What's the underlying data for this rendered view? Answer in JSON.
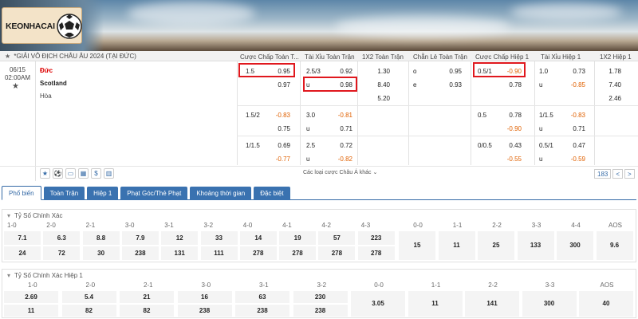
{
  "brand": {
    "logo_text": "KEONHACAI"
  },
  "match_header": {
    "star": "★",
    "tournament": "*GIẢI VÔ ĐỊCH CHÂU ÂU 2024 (TẠI ĐỨC)"
  },
  "columns": [
    "Cược Chấp Toàn T...",
    "Tài Xỉu Toàn Trận",
    "1X2 Toàn Trận",
    "Chẵn Lẻ Toàn Trận",
    "Cược Chấp Hiệp 1",
    "Tài Xỉu Hiệp 1",
    "1X2 Hiệp 1"
  ],
  "match": {
    "date": "06/15",
    "time": "02:00AM",
    "home": "Đức",
    "away": "Scotland",
    "draw": "Hòa"
  },
  "rows": [
    {
      "hdp": "1.5",
      "hdp_home": "0.95",
      "hdp_away": "0.97",
      "ou": "2.5/3",
      "ou_over": "0.92",
      "ou_u": "u",
      "ou_under": "0.98",
      "x12": [
        "1.30",
        "8.40",
        "5.20"
      ],
      "oe_o": "o",
      "oe_o_val": "0.95",
      "oe_e": "e",
      "oe_e_val": "0.93",
      "h1_hdp": "0.5/1",
      "h1_hdp_home": "-0.90",
      "h1_hdp_away": "0.78",
      "h1_ou": "1.0",
      "h1_ou_over": "0.73",
      "h1_ou_u": "u",
      "h1_ou_under": "-0.85",
      "h1_x12": [
        "1.78",
        "7.40",
        "2.46"
      ]
    },
    {
      "hdp": "1.5/2",
      "hdp_home": "-0.83",
      "hdp_away": "0.75",
      "ou": "3.0",
      "ou_over": "-0.81",
      "ou_u": "u",
      "ou_under": "0.71",
      "h1_hdp": "0.5",
      "h1_hdp_home": "0.78",
      "h1_hdp_away": "-0.90",
      "h1_ou": "1/1.5",
      "h1_ou_over": "-0.83",
      "h1_ou_u": "u",
      "h1_ou_under": "0.71"
    },
    {
      "hdp": "1/1.5",
      "hdp_home": "0.69",
      "hdp_away": "-0.77",
      "ou": "2.5",
      "ou_over": "0.72",
      "ou_u": "u",
      "ou_under": "-0.82",
      "h1_hdp": "0/0.5",
      "h1_hdp_home": "0.43",
      "h1_hdp_away": "-0.55",
      "h1_ou": "0.5/1",
      "h1_ou_over": "0.47",
      "h1_ou_u": "u",
      "h1_ou_under": "-0.59"
    }
  ],
  "more_link": "Các loại cược Châu Á khác",
  "pagination": {
    "count": "183",
    "prev": "<",
    "next": ">"
  },
  "tabs": [
    "Phổ biến",
    "Toàn Trận",
    "Hiệp 1",
    "Phạt Góc/Thẻ Phạt",
    "Khoảng thời gian",
    "Đặc biệt"
  ],
  "correct_score": {
    "title": "Tỷ Số Chính Xác",
    "home_labels": [
      "1-0",
      "2-0",
      "2-1",
      "3-0",
      "3-1",
      "3-2",
      "4-0",
      "4-1",
      "4-2",
      "4-3"
    ],
    "home_row1": [
      "7.1",
      "6.3",
      "8.8",
      "7.9",
      "12",
      "33",
      "14",
      "19",
      "57",
      "223"
    ],
    "home_row2": [
      "24",
      "72",
      "30",
      "238",
      "131",
      "111",
      "278",
      "278",
      "278",
      "278"
    ],
    "draw_labels": [
      "0-0",
      "1-1",
      "2-2",
      "3-3",
      "4-4",
      "AOS"
    ],
    "draw_values": [
      "15",
      "11",
      "25",
      "133",
      "300",
      "9.6"
    ]
  },
  "correct_score_h1": {
    "title": "Tỷ Số Chính Xác Hiệp 1",
    "home_labels": [
      "1-0",
      "2-0",
      "2-1",
      "3-0",
      "3-1",
      "3-2"
    ],
    "home_row1": [
      "2.69",
      "5.4",
      "21",
      "16",
      "63",
      "230"
    ],
    "home_row2": [
      "11",
      "82",
      "82",
      "238",
      "238",
      "238"
    ],
    "draw_labels": [
      "0-0",
      "1-1",
      "2-2",
      "3-3",
      "AOS"
    ],
    "draw_values": [
      "3.05",
      "11",
      "141",
      "300",
      "40"
    ]
  }
}
